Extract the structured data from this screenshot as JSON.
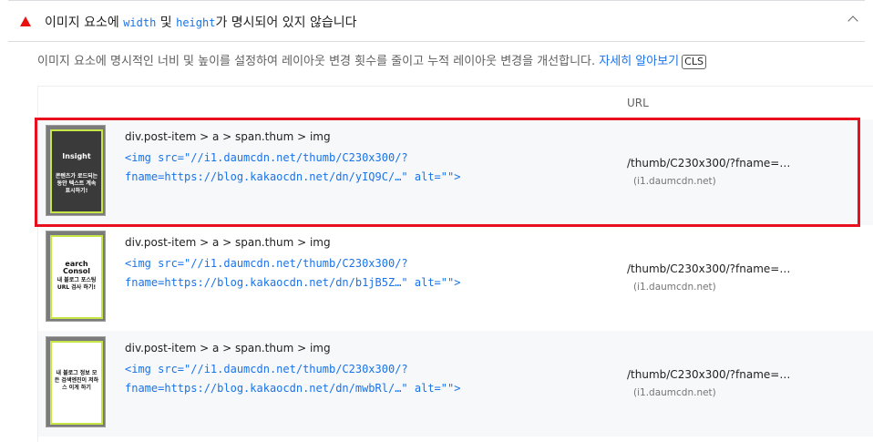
{
  "audit": {
    "title_pre": "이미지 요소에 ",
    "code1": "width",
    "title_mid": " 및 ",
    "code2": "height",
    "title_post": "가 명시되어 있지 않습니다",
    "status_icon": "warning-triangle-icon",
    "status_color": "#e8110f",
    "description": "이미지 요소에 명시적인 너비 및 높이를 설정하여 레이아웃 변경 횟수를 줄이고 누적 레이아웃 변경을 개선합니다. ",
    "learn_more": "자세히 알아보기",
    "tag": "CLS"
  },
  "table": {
    "url_header": "URL",
    "rows": [
      {
        "thumb_text_top": "Insight",
        "thumb_text": "콘텐츠가 로드되는 동안 텍스트 계속 표시하기!",
        "selector": "div.post-item > a > span.thum > img",
        "snippet_line1": "<img src=\"//i1.daumcdn.net/thumb/C230x300/?",
        "snippet_line2": "fname=https://blog.kakaocdn.net/dn/yIQ9C/…\" alt=\"\">",
        "url": "/thumb/C230x300/?fname=…",
        "host": "(i1.daumcdn.net)"
      },
      {
        "thumb_text_top": "earch Consol",
        "thumb_text": "내 블로그 포스팅 URL 검사 하기!",
        "selector": "div.post-item > a > span.thum > img",
        "snippet_line1": "<img src=\"//i1.daumcdn.net/thumb/C230x300/?",
        "snippet_line2": "fname=https://blog.kakaocdn.net/dn/b1jB5Z…\" alt=\"\">",
        "url": "/thumb/C230x300/?fname=…",
        "host": "(i1.daumcdn.net)"
      },
      {
        "thumb_text_top": "",
        "thumb_text": "내 블로그 정보 모든 검색엔진이 저하 스 이게 하기",
        "selector": "div.post-item > a > span.thum > img",
        "snippet_line1": "<img src=\"//i1.daumcdn.net/thumb/C230x300/?",
        "snippet_line2": "fname=https://blog.kakaocdn.net/dn/mwbRl/…\" alt=\"\">",
        "url": "/thumb/C230x300/?fname=…",
        "host": "(i1.daumcdn.net)"
      }
    ]
  },
  "colors": {
    "highlight": "#e8101e",
    "link": "#1a73e8",
    "thumb_border": "#c6e648"
  }
}
